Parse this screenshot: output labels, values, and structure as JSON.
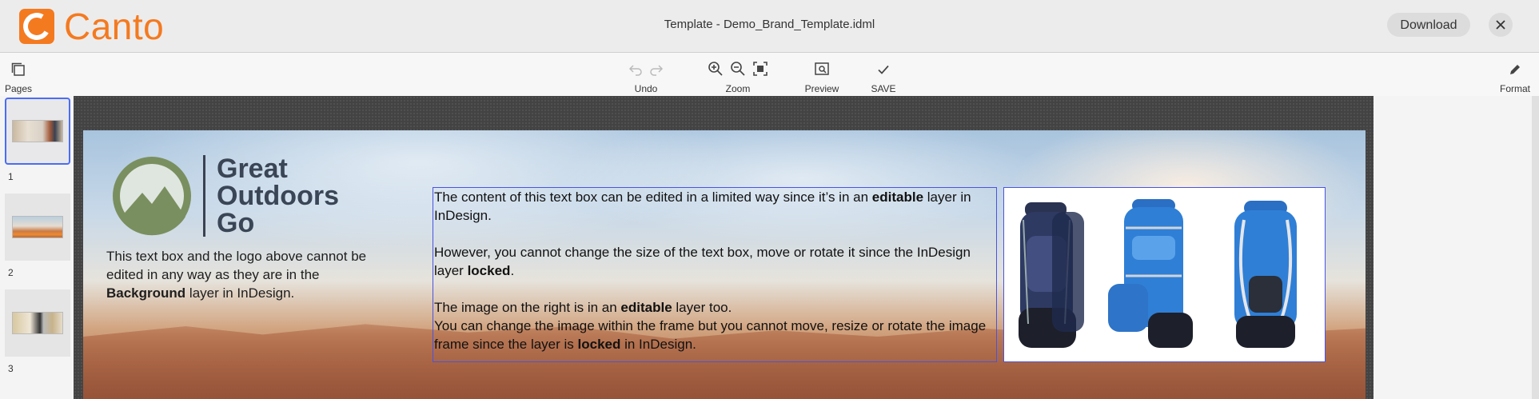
{
  "header": {
    "brand": "Canto",
    "title": "Template - Demo_Brand_Template.idml",
    "download_label": "Download"
  },
  "toolbar": {
    "pages_label": "Pages",
    "undo_label": "Undo",
    "zoom_label": "Zoom",
    "preview_label": "Preview",
    "save_label": "SAVE",
    "format_label": "Format"
  },
  "pages": [
    {
      "number": "1",
      "selected": true
    },
    {
      "number": "2",
      "selected": false
    },
    {
      "number": "3",
      "selected": false
    }
  ],
  "document": {
    "brand_lines": [
      "Great",
      "Outdoors",
      "Go"
    ],
    "bg_text": {
      "part1": "This text box and the logo above cannot be edited in any way as they are in the ",
      "bold": "Background",
      "part2": " layer in InDesign."
    },
    "editable_text": {
      "p1_a": "The content of this text box can be edited in a limited way since it’s in an ",
      "p1_b": "editable",
      "p1_c": " layer in InDesign.",
      "p2_a": "However, you cannot change the size of the text box, move or rotate it since the InDesign layer ",
      "p2_b": "locked",
      "p2_c": ".",
      "p3_a": "The image on the right is in an ",
      "p3_b": "editable",
      "p3_c": " layer too.",
      "p4_a": "You can change the image within the frame but you cannot move, resize or rotate the image frame since the layer is ",
      "p4_b": "locked",
      "p4_c": " in InDesign."
    }
  },
  "colors": {
    "accent": "#f47a20",
    "frame": "#4a54e0",
    "selection": "#4a6cf7"
  },
  "icons": [
    "pages-icon",
    "undo-icon",
    "redo-icon",
    "zoom-in-icon",
    "zoom-out-icon",
    "fit-screen-icon",
    "preview-icon",
    "check-icon",
    "pencil-icon",
    "close-icon"
  ]
}
